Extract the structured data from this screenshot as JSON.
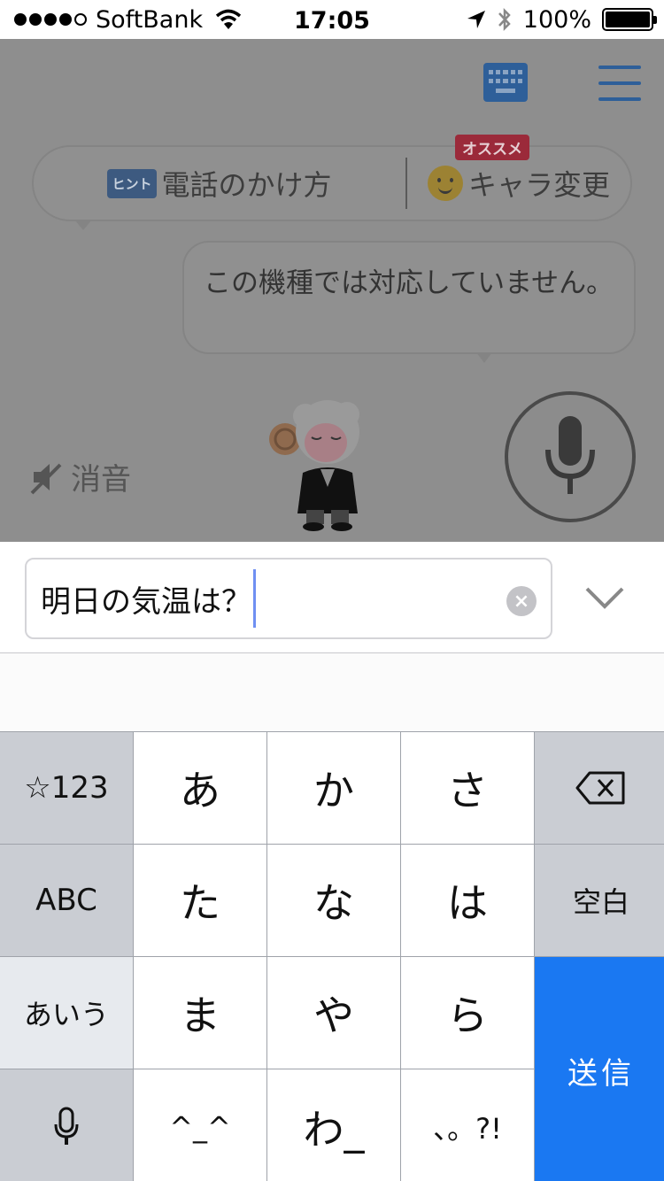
{
  "status_bar": {
    "carrier": "SoftBank",
    "time": "17:05",
    "battery": "100%",
    "signal_bars_filled": 4,
    "signal_bars_total": 5
  },
  "app": {
    "hint": {
      "tag": "ヒント",
      "text": "電話のかけ方",
      "badge": "オススメ",
      "char_change": "キャラ変更"
    },
    "reply": "この機種では対応していません。",
    "mute_label": "消音"
  },
  "input": {
    "value": "明日の気温は？",
    "clear_glyph": "×"
  },
  "keyboard": {
    "keys": {
      "symbols": "☆123",
      "a": "あ",
      "ka": "か",
      "sa": "さ",
      "abc": "ABC",
      "ta": "た",
      "na": "な",
      "ha": "は",
      "space": "空白",
      "aiu": "あいう",
      "ma": "ま",
      "ya": "や",
      "ra": "ら",
      "send": "送信",
      "face": "^_^",
      "wa": "わ_",
      "punct": "、。?!"
    }
  },
  "colors": {
    "accent": "#1a78f2",
    "header_icon": "#2e5f99",
    "dim_overlay": "#8e8e8e",
    "badge": "#9b2a3a"
  }
}
